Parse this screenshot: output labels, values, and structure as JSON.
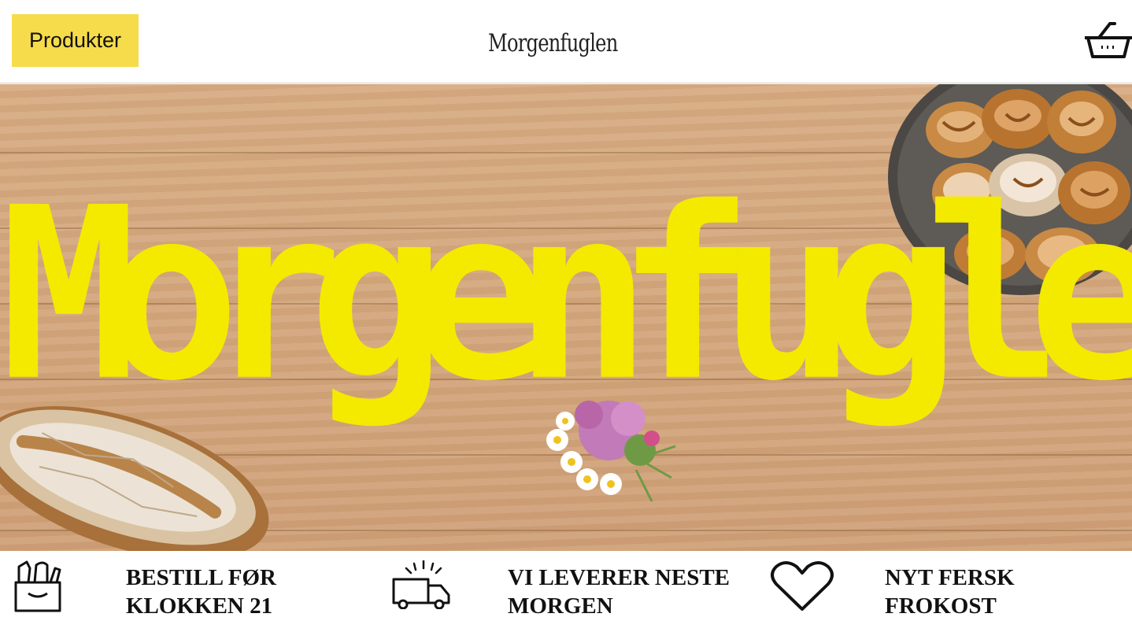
{
  "header": {
    "products_button": "Produkter",
    "logo_text": "Morgenfuglen",
    "cart_icon": "shopping-basket-icon"
  },
  "hero": {
    "title": "Morgenfuglen",
    "title_color": "#f3ea00"
  },
  "features": [
    {
      "icon": "grocery-bag-icon",
      "line1": "BESTILL FØR",
      "line2": "KLOKKEN 21"
    },
    {
      "icon": "delivery-truck-icon",
      "line1": "VI LEVERER NESTE",
      "line2": "MORGEN"
    },
    {
      "icon": "heart-icon",
      "line1": "NYT FERSK",
      "line2": "FROKOST"
    }
  ],
  "colors": {
    "accent_yellow": "#f6dc4a",
    "wood": "#d3a67c"
  }
}
